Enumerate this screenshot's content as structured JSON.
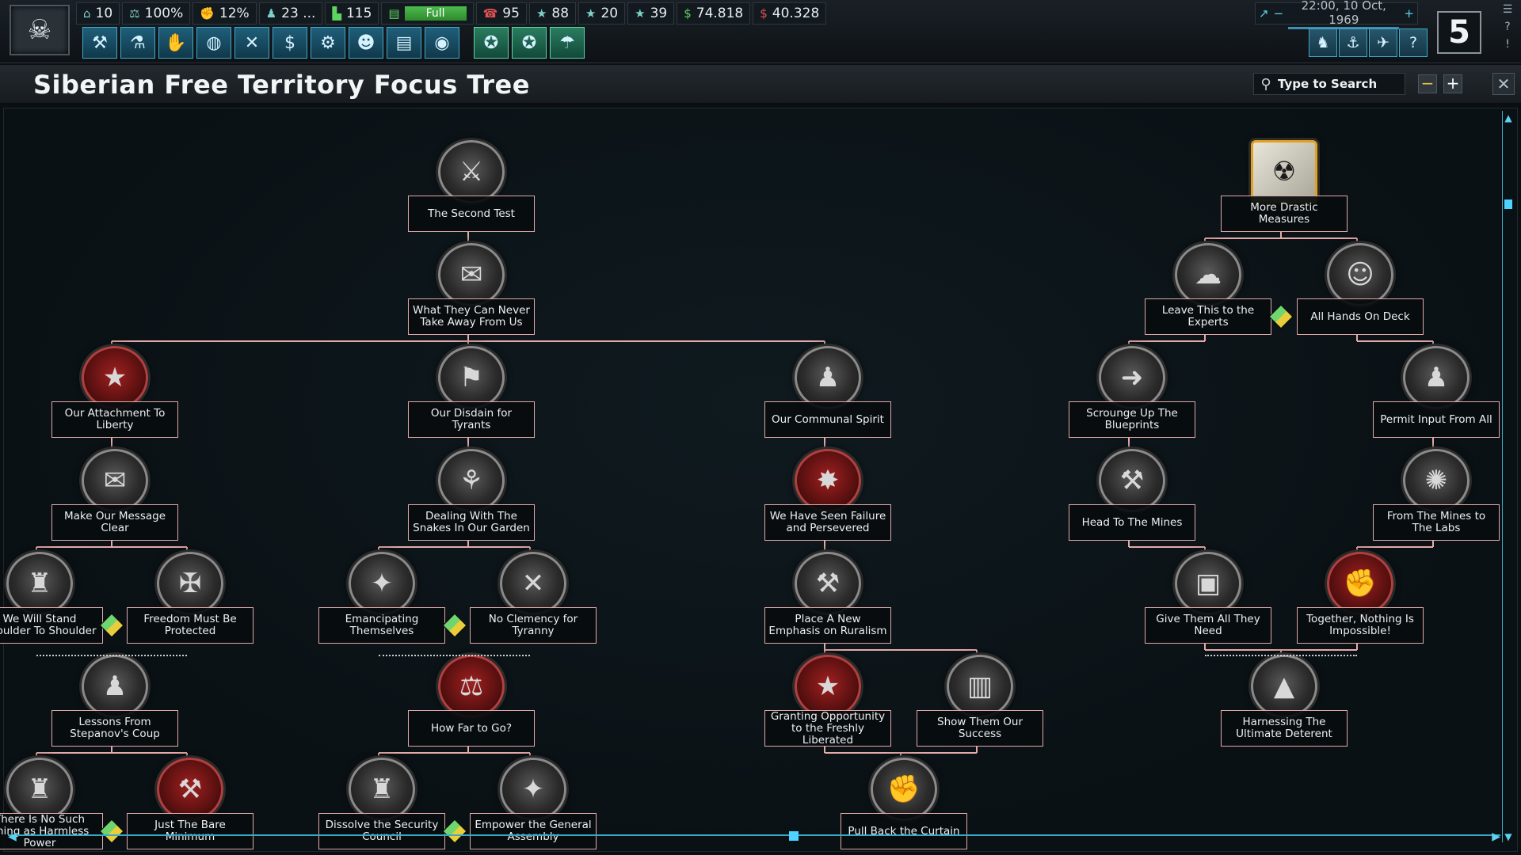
{
  "topbar": {
    "flag_icon": "skull-flag",
    "resources": [
      {
        "icon": "political-power-icon",
        "value": "10"
      },
      {
        "icon": "stability-icon",
        "value": "100%"
      },
      {
        "icon": "war-support-icon",
        "value": "12%"
      },
      {
        "icon": "manpower-icon",
        "value": "23 ..."
      },
      {
        "icon": "factories-icon",
        "value": "115"
      },
      {
        "icon": "fuel-icon",
        "value": "Full"
      },
      {
        "icon": "convoys-icon",
        "value": "95"
      },
      {
        "icon": "army-xp-icon",
        "value": "88"
      },
      {
        "icon": "navy-xp-icon",
        "value": "20"
      },
      {
        "icon": "air-xp-icon",
        "value": "39"
      },
      {
        "icon": "money-income-icon",
        "value": "74.818"
      },
      {
        "icon": "money-expense-icon",
        "value": "40.328"
      }
    ],
    "datetime": "22:00, 10 Oct, 1969",
    "game_speed": "5",
    "menu_buttons": [
      "production",
      "research",
      "diplomacy",
      "world",
      "construction",
      "economy",
      "settings",
      "intel",
      "decisions",
      "logistics"
    ],
    "alert_buttons": [
      "alert-1",
      "alert-2",
      "alert-3"
    ],
    "right_buttons": [
      "army",
      "navy",
      "air",
      "help"
    ]
  },
  "header": {
    "title": "Siberian Free Territory Focus Tree",
    "search_placeholder": "Type to Search"
  },
  "nodes": [
    {
      "id": "second_test",
      "label": "The Second Test"
    },
    {
      "id": "never_take",
      "label": "What They Can Never Take Away From Us"
    },
    {
      "id": "attachment_liberty",
      "label": "Our Attachment To Liberty"
    },
    {
      "id": "disdain_tyrants",
      "label": "Our Disdain for Tyrants"
    },
    {
      "id": "communal_spirit",
      "label": "Our Communal Spirit"
    },
    {
      "id": "message_clear",
      "label": "Make Our Message Clear"
    },
    {
      "id": "snakes_garden",
      "label": "Dealing With The Snakes In Our Garden"
    },
    {
      "id": "seen_failure",
      "label": "We Have Seen Failure and Persevered"
    },
    {
      "id": "shoulder",
      "label": "We Will Stand Shoulder To Shoulder"
    },
    {
      "id": "freedom_protected",
      "label": "Freedom Must Be Protected"
    },
    {
      "id": "emancipating",
      "label": "Emancipating Themselves"
    },
    {
      "id": "no_clemency",
      "label": "No Clemency for Tyranny"
    },
    {
      "id": "ruralism",
      "label": "Place A New Emphasis on Ruralism"
    },
    {
      "id": "stepanov",
      "label": "Lessons From Stepanov's Coup"
    },
    {
      "id": "how_far",
      "label": "How Far to Go?"
    },
    {
      "id": "granting_opportunity",
      "label": "Granting Opportunity to the Freshly Liberated"
    },
    {
      "id": "show_success",
      "label": "Show Them Our Success"
    },
    {
      "id": "harmless_power",
      "label": "There Is No Such Thing as Harmless Power"
    },
    {
      "id": "bare_minimum",
      "label": "Just The Bare Minimum"
    },
    {
      "id": "dissolve_council",
      "label": "Dissolve the Security Council"
    },
    {
      "id": "empower_assembly",
      "label": "Empower the General Assembly"
    },
    {
      "id": "pull_curtain",
      "label": "Pull Back the Curtain"
    },
    {
      "id": "drastic_measures",
      "label": "More Drastic Measures"
    },
    {
      "id": "leave_experts",
      "label": "Leave This to the Experts"
    },
    {
      "id": "all_hands",
      "label": "All Hands On Deck"
    },
    {
      "id": "scrounge",
      "label": "Scrounge Up The Blueprints"
    },
    {
      "id": "permit_input",
      "label": "Permit Input From All"
    },
    {
      "id": "head_mines",
      "label": "Head To The Mines"
    },
    {
      "id": "mines_labs",
      "label": "From The Mines to The Labs"
    },
    {
      "id": "give_need",
      "label": "Give Them All They Need"
    },
    {
      "id": "together_impossible",
      "label": "Together, Nothing Is Impossible!"
    },
    {
      "id": "ultimate_deterent",
      "label": "Harnessing The Ultimate Deterent"
    }
  ]
}
